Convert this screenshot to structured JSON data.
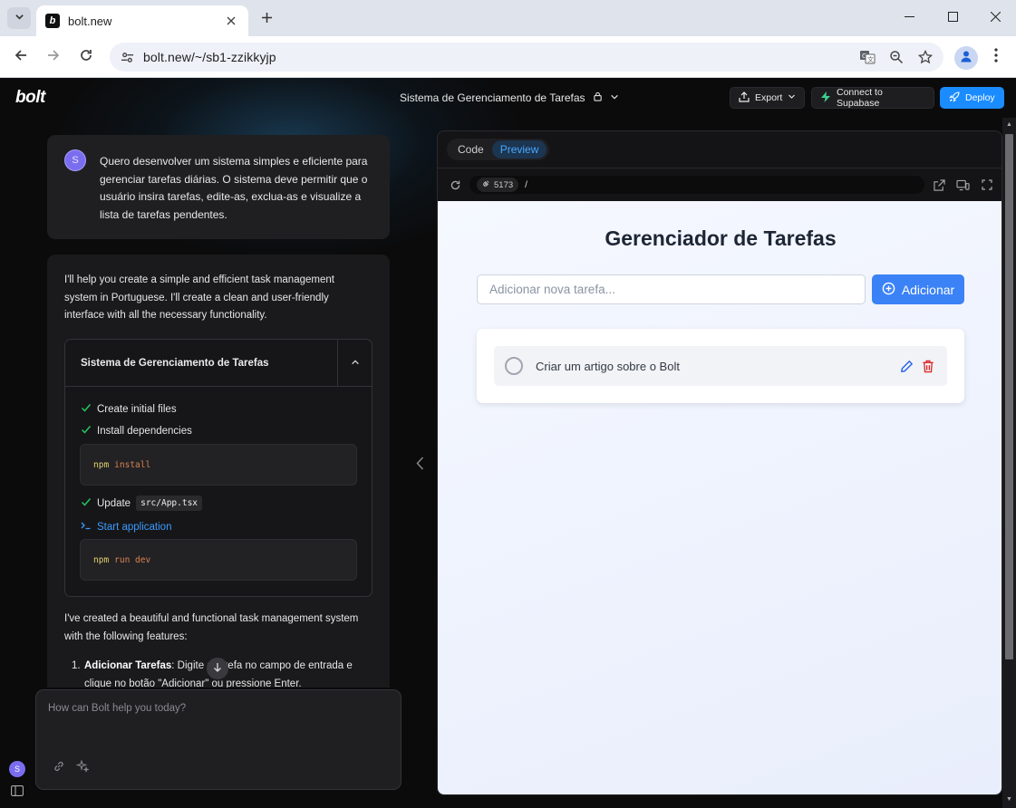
{
  "browser": {
    "tab_title": "bolt.new",
    "favicon_letter": "b",
    "url": "bolt.new/~/sb1-zzikkyjp"
  },
  "app": {
    "logo": "bolt",
    "project_title": "Sistema de Gerenciamento de Tarefas",
    "export_label": "Export",
    "supabase_label": "Connect to Supabase",
    "deploy_label": "Deploy"
  },
  "chat": {
    "user_avatar": "S",
    "user_message": "Quero desenvolver um sistema simples e eficiente para gerenciar tarefas diárias. O sistema deve permitir que o usuário insira tarefas, edite-as, exclua-as e visualize a lista de tarefas pendentes.",
    "assistant_intro": "I'll help you create a simple and efficient task management system in Portuguese. I'll create a clean and user-friendly interface with all the necessary functionality.",
    "artifact": {
      "title": "Sistema de Gerenciamento de Tarefas",
      "step1": "Create initial files",
      "step2": "Install dependencies",
      "cmd1_npm": "npm",
      "cmd1_args": "install",
      "step3_label": "Update",
      "step3_file": "src/App.tsx",
      "step4": "Start application",
      "cmd2_npm": "npm",
      "cmd2_args": "run dev"
    },
    "assistant_after": "I've created a beautiful and functional task management system with the following features:",
    "list_item1_bold": "Adicionar Tarefas",
    "list_item1_text": ": Digite a tarefa no campo de entrada e clique no botão \"Adicionar\" ou pressione Enter.",
    "input_placeholder": "How can Bolt help you today?",
    "sidebar_avatar": "S"
  },
  "workbench": {
    "tab_code": "Code",
    "tab_preview": "Preview",
    "port": "5173",
    "path": "/"
  },
  "preview": {
    "title": "Gerenciador de Tarefas",
    "input_placeholder": "Adicionar nova tarefa...",
    "add_label": "Adicionar",
    "tasks": [
      {
        "text": "Criar um artigo sobre o Bolt",
        "done": false
      }
    ]
  },
  "colors": {
    "accent": "#1a8cff",
    "preview_button": "#3b82f6",
    "check": "#22c55e",
    "delete": "#dc2626"
  }
}
